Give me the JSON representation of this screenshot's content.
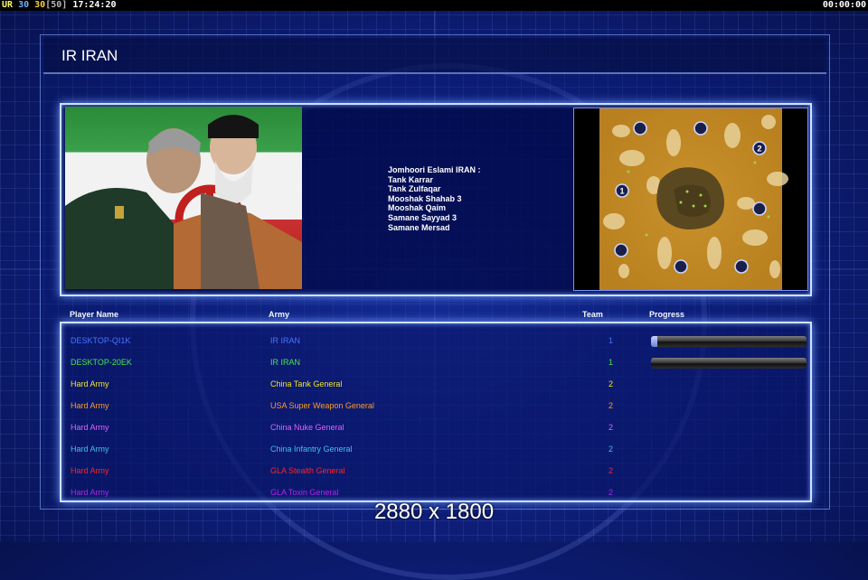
{
  "topbar": {
    "ur_label": "UR",
    "value_a": "30",
    "value_b": "30",
    "value_c": "[50]",
    "clock": "17:24:20",
    "timer": "00:00:00"
  },
  "screen": {
    "title": "IR IRAN"
  },
  "briefing": {
    "lines": [
      "Jomhoori Eslami IRAN :",
      "Tank Karrar",
      "Tank Zulfaqar",
      "Mooshak Shahab 3",
      "Mooshak Qaim",
      "Samane Sayyad 3",
      "Samane Mersad"
    ]
  },
  "map": {
    "start_positions": [
      "1",
      "2"
    ]
  },
  "table": {
    "headers": {
      "player": "Player Name",
      "army": "Army",
      "team": "Team",
      "progress": "Progress"
    },
    "rows": [
      {
        "player": "DESKTOP-QI1K",
        "army": "IR IRAN",
        "team": "1",
        "color": "#4a74ff",
        "progress": 0.04
      },
      {
        "player": "DESKTOP-20EK",
        "army": "IR IRAN",
        "team": "1",
        "color": "#45e84b",
        "progress": 0.0
      },
      {
        "player": "Hard Army",
        "army": "China Tank General",
        "team": "2",
        "color": "#f0e426"
      },
      {
        "player": "Hard Army",
        "army": "USA Super Weapon General",
        "team": "2",
        "color": "#ff9c1f"
      },
      {
        "player": "Hard Army",
        "army": "China Nuke General",
        "team": "2",
        "color": "#e061ff"
      },
      {
        "player": "Hard Army",
        "army": "China Infantry General",
        "team": "2",
        "color": "#3ec1e8"
      },
      {
        "player": "Hard Army",
        "army": "GLA Stealth General",
        "team": "2",
        "color": "#ff2424"
      },
      {
        "player": "Hard Army",
        "army": "GLA Toxin General",
        "team": "2",
        "color": "#b125e8"
      }
    ]
  },
  "resolution_label": "2880 x 1800"
}
